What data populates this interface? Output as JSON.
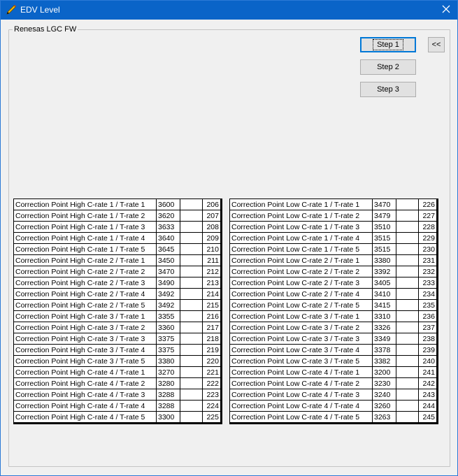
{
  "window": {
    "title": "EDV Level"
  },
  "group": {
    "label": "Renesas LGC FW"
  },
  "buttons": {
    "step1": "Step 1",
    "step2": "Step 2",
    "step3": "Step 3",
    "collapse": "<<"
  },
  "left_table": [
    {
      "label": "Correction Point High C-rate 1 / T-rate 1",
      "value": "3600",
      "index": "206"
    },
    {
      "label": "Correction Point High C-rate 1 / T-rate 2",
      "value": "3620",
      "index": "207"
    },
    {
      "label": "Correction Point High C-rate 1 / T-rate 3",
      "value": "3633",
      "index": "208"
    },
    {
      "label": "Correction Point High C-rate 1 / T-rate 4",
      "value": "3640",
      "index": "209"
    },
    {
      "label": "Correction Point High C-rate 1 / T-rate 5",
      "value": "3645",
      "index": "210"
    },
    {
      "label": "Correction Point High C-rate 2 / T-rate 1",
      "value": "3450",
      "index": "211"
    },
    {
      "label": "Correction Point High C-rate 2 / T-rate 2",
      "value": "3470",
      "index": "212"
    },
    {
      "label": "Correction Point High C-rate 2 / T-rate 3",
      "value": "3490",
      "index": "213"
    },
    {
      "label": "Correction Point High C-rate 2 / T-rate 4",
      "value": "3492",
      "index": "214"
    },
    {
      "label": "Correction Point High C-rate 2 / T-rate 5",
      "value": "3492",
      "index": "215"
    },
    {
      "label": "Correction Point High C-rate 3 / T-rate 1",
      "value": "3355",
      "index": "216"
    },
    {
      "label": "Correction Point High C-rate 3 / T-rate 2",
      "value": "3360",
      "index": "217"
    },
    {
      "label": "Correction Point High C-rate 3 / T-rate 3",
      "value": "3375",
      "index": "218"
    },
    {
      "label": "Correction Point High C-rate 3 / T-rate 4",
      "value": "3375",
      "index": "219"
    },
    {
      "label": "Correction Point High C-rate 3 / T-rate 5",
      "value": "3380",
      "index": "220"
    },
    {
      "label": "Correction Point High C-rate 4 / T-rate 1",
      "value": "3270",
      "index": "221"
    },
    {
      "label": "Correction Point High C-rate 4 / T-rate 2",
      "value": "3280",
      "index": "222"
    },
    {
      "label": "Correction Point High C-rate 4 / T-rate 3",
      "value": "3288",
      "index": "223"
    },
    {
      "label": "Correction Point High C-rate 4 / T-rate 4",
      "value": "3288",
      "index": "224"
    },
    {
      "label": "Correction Point High C-rate 4 / T-rate 5",
      "value": "3300",
      "index": "225"
    }
  ],
  "right_table": [
    {
      "label": "Correction Point Low C-rate 1 / T-rate 1",
      "value": "3470",
      "index": "226"
    },
    {
      "label": "Correction Point Low C-rate 1 / T-rate 2",
      "value": "3479",
      "index": "227"
    },
    {
      "label": "Correction Point Low C-rate 1 / T-rate 3",
      "value": "3510",
      "index": "228"
    },
    {
      "label": "Correction Point Low C-rate 1 / T-rate 4",
      "value": "3515",
      "index": "229"
    },
    {
      "label": "Correction Point Low C-rate 1 / T-rate 5",
      "value": "3515",
      "index": "230"
    },
    {
      "label": "Correction Point Low C-rate 2 / T-rate 1",
      "value": "3380",
      "index": "231"
    },
    {
      "label": "Correction Point Low C-rate 2 / T-rate 2",
      "value": "3392",
      "index": "232"
    },
    {
      "label": "Correction Point Low C-rate 2 / T-rate 3",
      "value": "3405",
      "index": "233"
    },
    {
      "label": "Correction Point Low C-rate 2 / T-rate 4",
      "value": "3410",
      "index": "234"
    },
    {
      "label": "Correction Point Low C-rate 2 / T-rate 5",
      "value": "3415",
      "index": "235"
    },
    {
      "label": "Correction Point Low C-rate 3 / T-rate 1",
      "value": "3310",
      "index": "236"
    },
    {
      "label": "Correction Point Low C-rate 3 / T-rate 2",
      "value": "3326",
      "index": "237"
    },
    {
      "label": "Correction Point Low C-rate 3 / T-rate 3",
      "value": "3349",
      "index": "238"
    },
    {
      "label": "Correction Point Low C-rate 3 / T-rate 4",
      "value": "3378",
      "index": "239"
    },
    {
      "label": "Correction Point Low C-rate 3 / T-rate 5",
      "value": "3382",
      "index": "240"
    },
    {
      "label": "Correction Point Low C-rate 4 / T-rate 1",
      "value": "3200",
      "index": "241"
    },
    {
      "label": "Correction Point Low C-rate 4 / T-rate 2",
      "value": "3230",
      "index": "242"
    },
    {
      "label": "Correction Point Low C-rate 4 / T-rate 3",
      "value": "3240",
      "index": "243"
    },
    {
      "label": "Correction Point Low C-rate 4 / T-rate 4",
      "value": "3260",
      "index": "244"
    },
    {
      "label": "Correction Point Low C-rate 4 / T-rate 5",
      "value": "3263",
      "index": "245"
    }
  ]
}
